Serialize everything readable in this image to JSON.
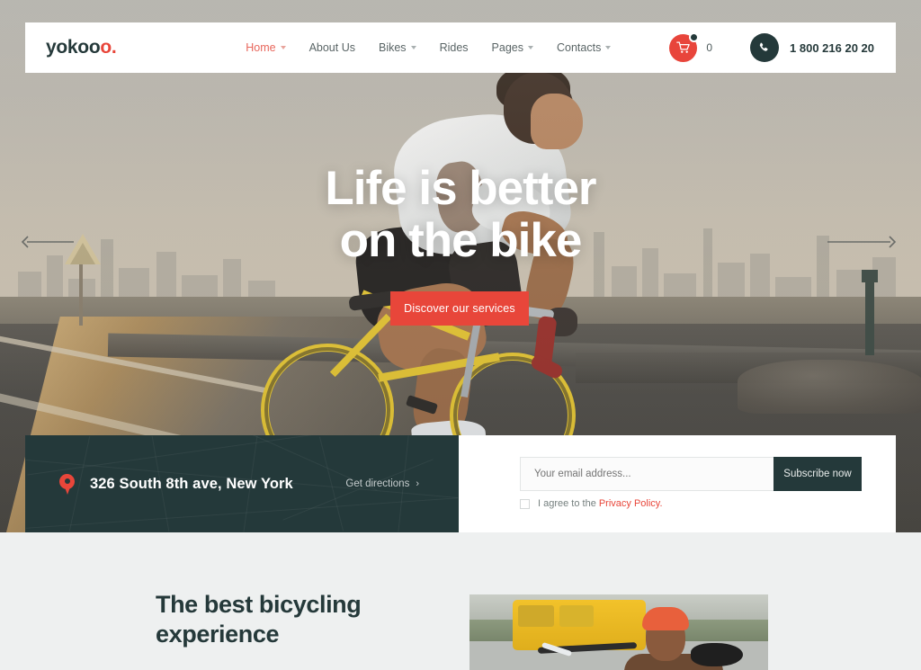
{
  "header": {
    "logo_text": "yokoo",
    "logo_accent": "o.",
    "nav": [
      {
        "label": "Home",
        "active": true,
        "has_caret": true
      },
      {
        "label": "About Us",
        "active": false,
        "has_caret": false
      },
      {
        "label": "Bikes",
        "active": false,
        "has_caret": true
      },
      {
        "label": "Rides",
        "active": false,
        "has_caret": false
      },
      {
        "label": "Pages",
        "active": false,
        "has_caret": true
      },
      {
        "label": "Contacts",
        "active": false,
        "has_caret": true
      }
    ],
    "cart": {
      "icon": "shopping-cart-icon",
      "count": "0"
    },
    "phone": {
      "icon": "phone-icon",
      "number": "1 800 216 20 20"
    }
  },
  "hero": {
    "title_line1": "Life is better",
    "title_line2": "on the bike",
    "cta_label": "Discover our services",
    "prev_icon": "arrow-left-icon",
    "next_icon": "arrow-right-icon"
  },
  "info": {
    "address": "326 South 8th ave, New York",
    "pin_icon": "map-pin-icon",
    "directions_label": "Get directions",
    "directions_chevron": "›"
  },
  "subscribe": {
    "email_placeholder": "Your email address...",
    "email_value": "",
    "button_label": "Subscribe now",
    "agree_prefix": "I agree to the",
    "privacy_link": "Privacy Policy."
  },
  "section": {
    "title": "The best bicycling experience",
    "photo_alt": "cyclist-photo"
  },
  "colors": {
    "accent_red": "#e8463a",
    "dark_teal": "#24393a",
    "page_bg": "#a9afae",
    "section_bg": "#eef0f0"
  }
}
